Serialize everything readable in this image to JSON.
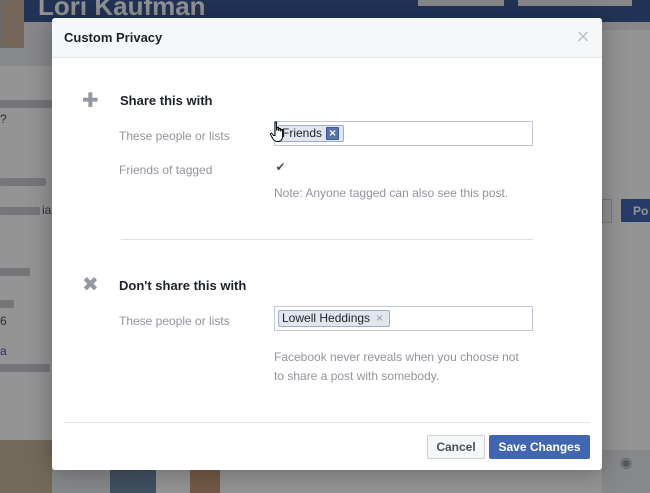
{
  "background": {
    "profile_name": "Lori Kaufman",
    "left_chars": [
      "?",
      "ia",
      "a",
      "6"
    ],
    "post_button": "Po",
    "camera_icon": "camera-icon"
  },
  "dialog": {
    "title": "Custom Privacy",
    "close_icon": "close-icon",
    "share": {
      "icon": "plus-icon",
      "title": "Share this with",
      "people_label": "These people or lists",
      "tokens": [
        {
          "label": "Friends",
          "remove_icon": "close-icon"
        }
      ],
      "tagged_label": "Friends of tagged",
      "tagged_checked": true,
      "note": "Note: Anyone tagged can also see this post."
    },
    "dont_share": {
      "icon": "x-icon",
      "title": "Don't share this with",
      "people_label": "These people or lists",
      "tokens": [
        {
          "label": "Lowell Heddings",
          "remove_icon": "close-icon"
        }
      ],
      "note_line1": "Facebook never reveals when you choose not",
      "note_line2": "to share a post with somebody."
    },
    "footer": {
      "cancel_label": "Cancel",
      "save_label": "Save Changes"
    }
  },
  "colors": {
    "accent": "#4267b2",
    "token_bg": "#e2e6ef",
    "token_border": "#9daccb"
  }
}
